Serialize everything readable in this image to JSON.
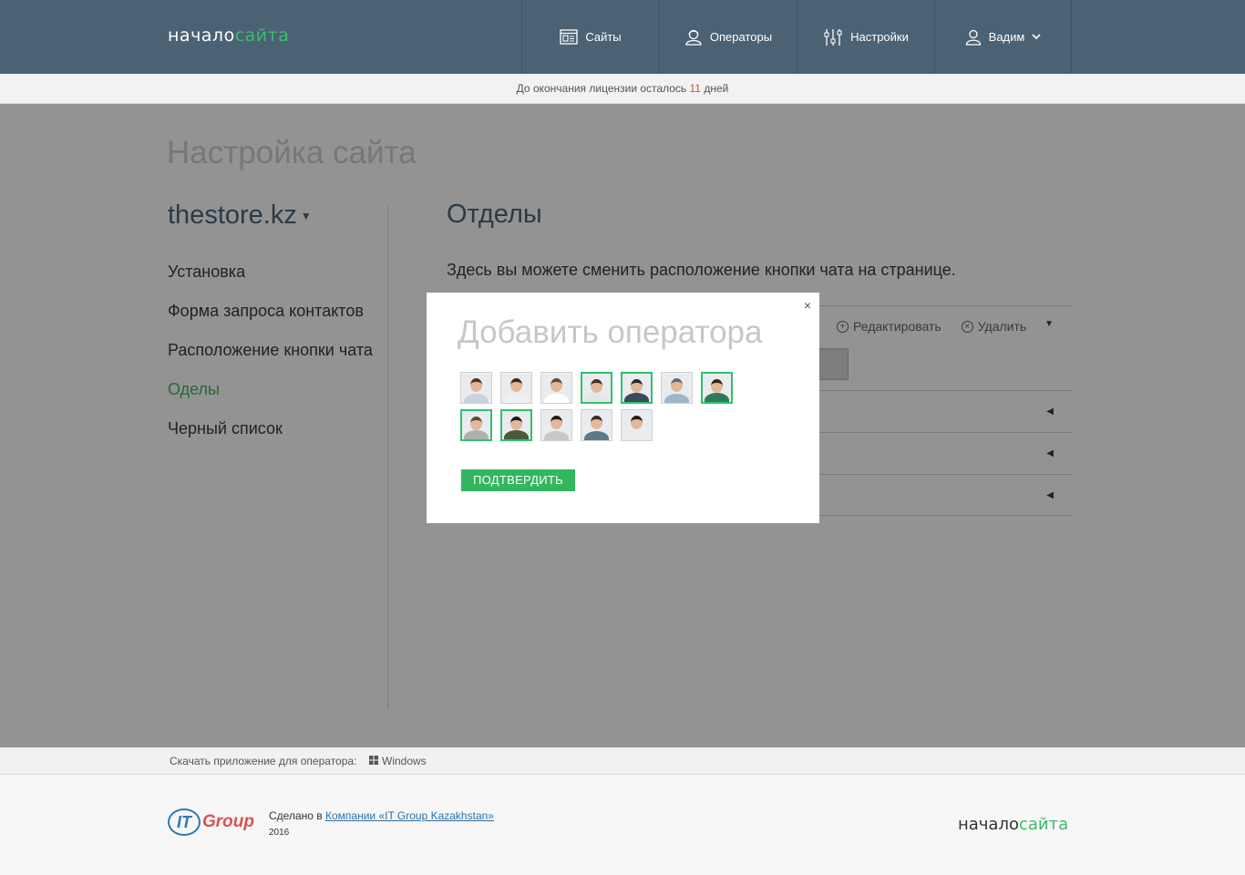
{
  "header": {
    "logo_part1": "начало",
    "logo_part2": "сайта",
    "nav": [
      {
        "label": "Сайты",
        "icon": "sites-icon"
      },
      {
        "label": "Операторы",
        "icon": "operators-icon"
      },
      {
        "label": "Настройки",
        "icon": "settings-sliders-icon"
      },
      {
        "label": "Вадим",
        "icon": "user-icon"
      }
    ]
  },
  "license": {
    "prefix": "До окончания лицензии осталось",
    "days": "11",
    "suffix": "дней"
  },
  "main": {
    "page_title": "Настройка сайта",
    "site_name": "thestore.kz",
    "menu": [
      "Установка",
      "Форма запроса контактов",
      "Расположение кнопки чата",
      "Оделы",
      "Черный список"
    ],
    "active_menu_index": 3,
    "section_title": "Отделы",
    "section_desc": "Здесь вы можете сменить расположение кнопки чата на странице.",
    "row_actions": {
      "edit": "Редактировать",
      "delete": "Удалить"
    }
  },
  "footer": {
    "download_label": "Скачать приложение для оператора:",
    "windows_label": "Windows",
    "it_logo": "IT",
    "it_group": "Group",
    "made_prefix": "Сделано в",
    "made_link": "Компании «IT Group Kazakhstan»",
    "year": "2016",
    "logo_part1": "начало",
    "logo_part2": "сайта"
  },
  "modal": {
    "title": "Добавить оператора",
    "close": "×",
    "confirm_label": "ПОДТВЕРДИТЬ",
    "operators": [
      {
        "selected": false,
        "hair": "#5a3020",
        "shirt": "#c9d4de"
      },
      {
        "selected": false,
        "hair": "#3a2a20",
        "shirt": "#f0f0f0"
      },
      {
        "selected": false,
        "hair": "#6b4a2a",
        "shirt": "#ffffff"
      },
      {
        "selected": true,
        "hair": "#4a3020",
        "shirt": "#e6e6e6"
      },
      {
        "selected": true,
        "hair": "#2a2a2a",
        "shirt": "#3a4a5a"
      },
      {
        "selected": false,
        "hair": "#6a6a6a",
        "shirt": "#9fb7c7"
      },
      {
        "selected": true,
        "hair": "#3a2515",
        "shirt": "#2d7a5a"
      },
      {
        "selected": true,
        "hair": "#5a4a3a",
        "shirt": "#b0b0b0"
      },
      {
        "selected": true,
        "hair": "#1a1a1a",
        "shirt": "#4a5a3a"
      },
      {
        "selected": false,
        "hair": "#2a1a10",
        "shirt": "#c8c8c8"
      },
      {
        "selected": false,
        "hair": "#3a2a20",
        "shirt": "#5a7a8a"
      },
      {
        "selected": false,
        "hair": "#2a1a10",
        "shirt": "#ececec"
      }
    ]
  },
  "colors": {
    "accent": "#33b660",
    "header": "#4b6275",
    "license_days": "#e8453c"
  }
}
